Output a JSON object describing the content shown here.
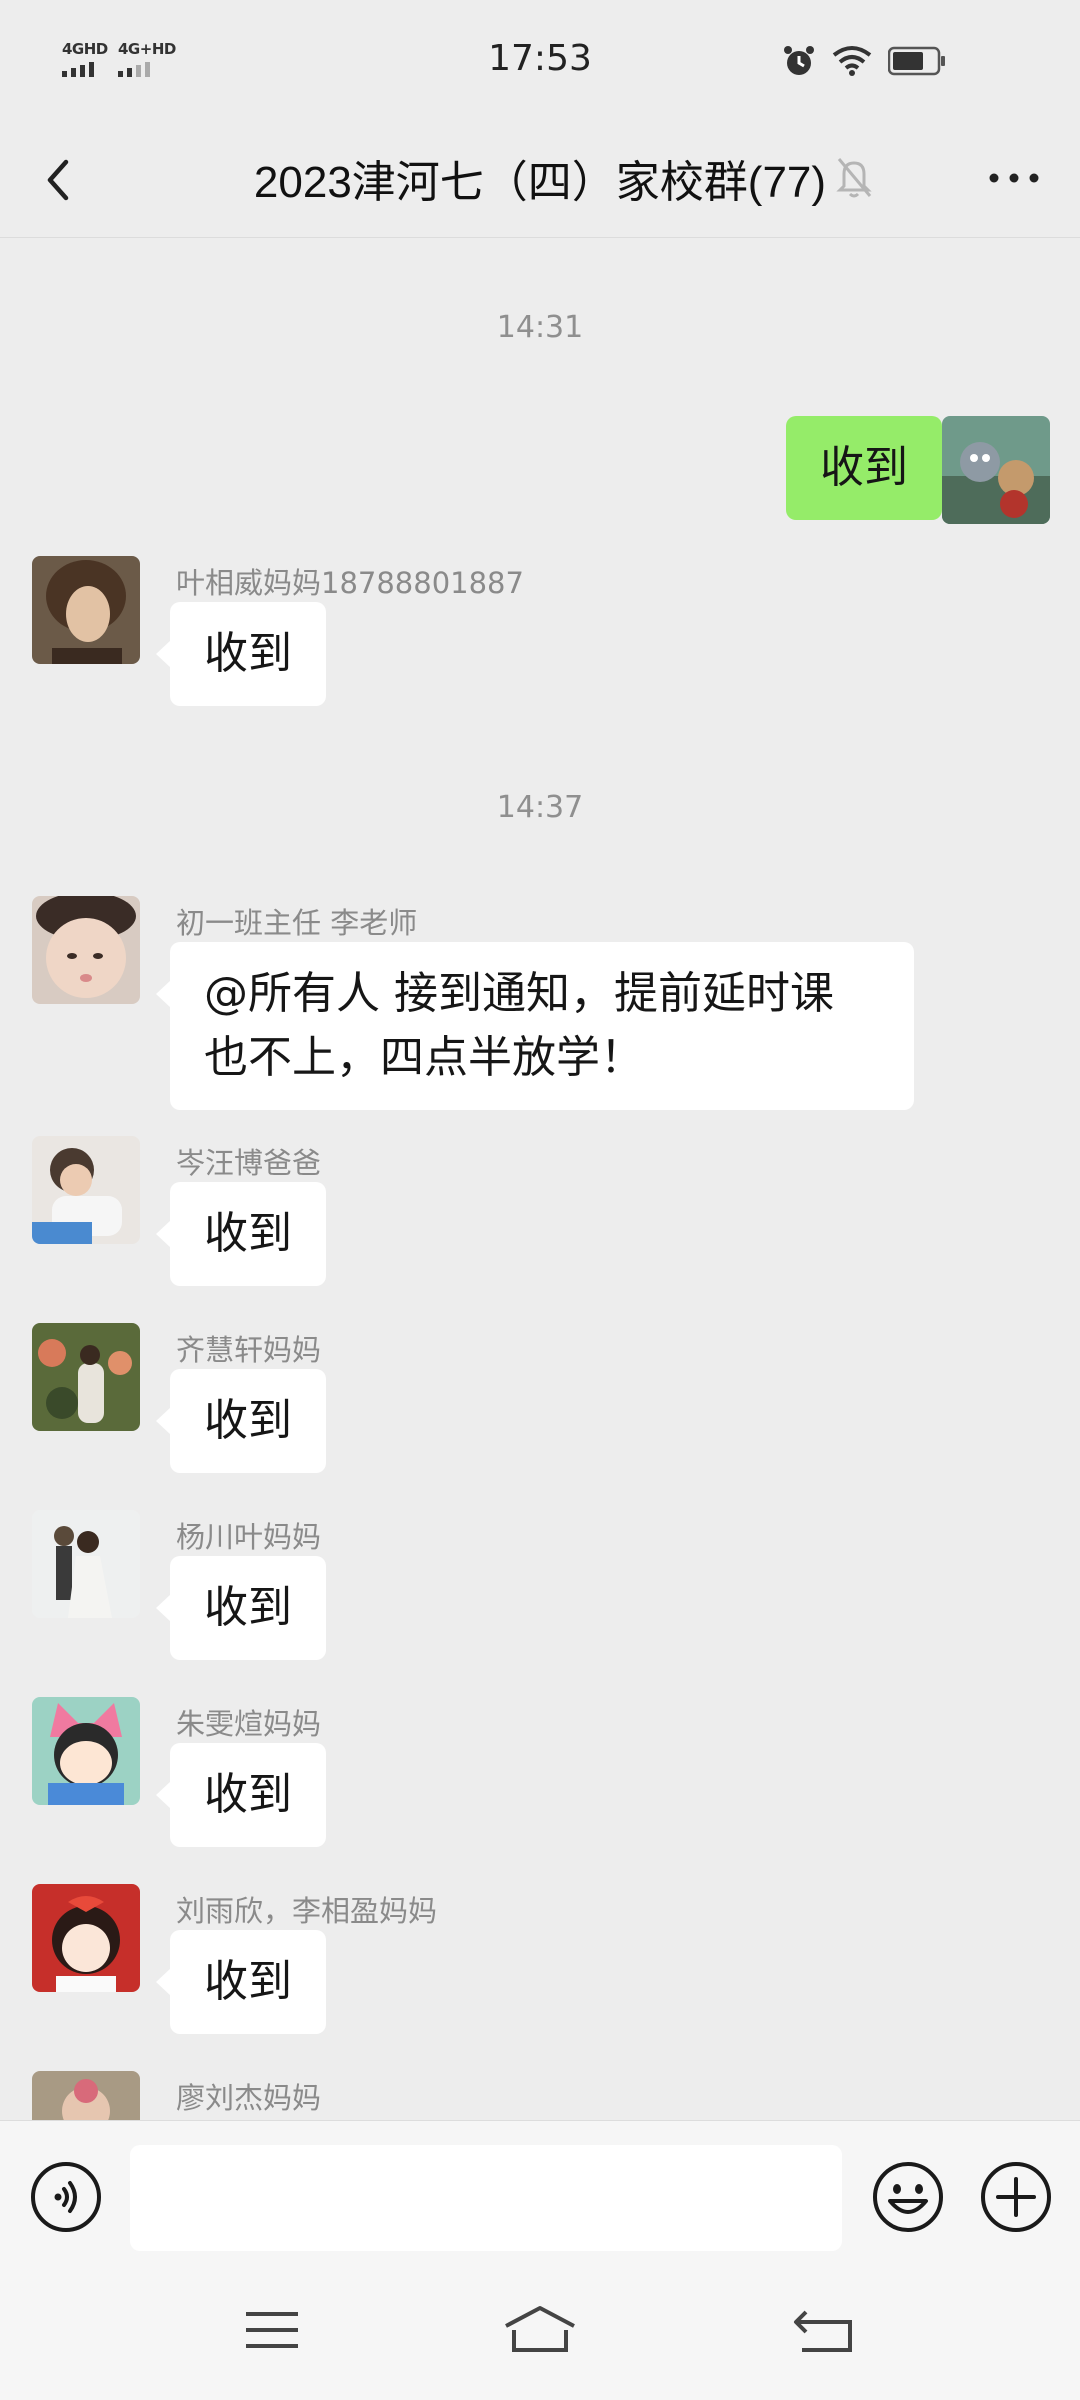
{
  "status_bar": {
    "sim1": "4GHD",
    "sim2": "4G+HD",
    "time": "17:53"
  },
  "header": {
    "title": "2023津河七（四）家校群(77)",
    "icons": [
      "back-icon",
      "mute-bell-icon",
      "more-icon"
    ]
  },
  "chat": {
    "timestamps": [
      "14:31",
      "14:37"
    ],
    "messages": [
      {
        "mine": true,
        "text": "收到"
      },
      {
        "sender": "叶相威妈妈18788801887",
        "text": "收到"
      },
      {
        "sender": "初一班主任 李老师",
        "text_line1": "@所有人  接到通知，提前延时课",
        "text_line2": "也不上，四点半放学！"
      },
      {
        "sender": "岑汪博爸爸",
        "text": "收到"
      },
      {
        "sender": "齐慧轩妈妈",
        "text": "收到"
      },
      {
        "sender": "杨川叶妈妈",
        "text": "收到"
      },
      {
        "sender": "朱雯煊妈妈",
        "text": "收到"
      },
      {
        "sender": "刘雨欣，李相盈妈妈",
        "text": "收到"
      },
      {
        "sender": "廖刘杰妈妈",
        "text": ""
      }
    ]
  },
  "input_bar": {
    "icons": [
      "voice-icon",
      "emoji-icon",
      "plus-icon"
    ],
    "value": ""
  },
  "nav_bar": {
    "icons": [
      "menu-icon",
      "home-icon",
      "back-nav-icon"
    ]
  },
  "colors": {
    "background": "#ededed",
    "my_bubble": "#95ec69",
    "other_bubble": "#ffffff",
    "meta_text": "#8a8a8a"
  }
}
